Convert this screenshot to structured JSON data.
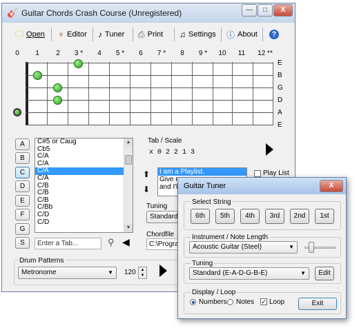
{
  "window": {
    "title": "Guitar Chords Crash Course (Unregistered)",
    "caption_min": "—",
    "caption_max": "□",
    "caption_close": "X"
  },
  "toolbar": {
    "open": "Open",
    "editor": "Editor",
    "tuner": "Tuner",
    "print": "Print",
    "settings": "Settings",
    "about": "About",
    "help": "?"
  },
  "fretboard": {
    "fret_labels": [
      "0",
      "1",
      "2",
      "3 *",
      "4",
      "5 *",
      "6",
      "7 *",
      "8",
      "9 *",
      "10",
      "11",
      "12 **"
    ],
    "string_names": [
      "E",
      "B",
      "G",
      "D",
      "A",
      "E"
    ]
  },
  "letters": [
    "A",
    "B",
    "C",
    "D",
    "E",
    "F",
    "G",
    "S"
  ],
  "selected_letter": "C",
  "chord_list": [
    "C#5 or Caug",
    "Cb5",
    "C/A",
    "C/A",
    "C/A",
    "C/A",
    "C/B",
    "C/B",
    "C/B",
    "C/Bb",
    "C/D",
    "C/D"
  ],
  "selected_chord_index": 3,
  "tab_search_placeholder": "Enter a Tab...",
  "tab_scale": {
    "label": "Tab / Scale",
    "value": "x 0 2 2 1 3"
  },
  "playlist": {
    "lines": [
      "I am a Playlist.",
      "Give m",
      "and I'l"
    ],
    "checkbox_label": "Play List"
  },
  "tuning": {
    "label": "Tuning",
    "value": "Standard ("
  },
  "chordfile": {
    "label": "Chordfile",
    "value": "C:\\Program"
  },
  "drum": {
    "label": "Drum Patterns",
    "value": "Metronome",
    "tempo": "120"
  },
  "tuner": {
    "title": "Guitar Tuner",
    "select_string_label": "Select String",
    "strings": [
      "6th",
      "5th",
      "4th",
      "3rd",
      "2nd",
      "1st"
    ],
    "instrument_label": "Instrument / Note Length",
    "instrument_value": "Acoustic Guitar (Steel)",
    "tuning_label": "Tuning",
    "tuning_value": "Standard (E-A-D-G-B-E)",
    "edit_label": "Edit",
    "display_label": "Display / Loop",
    "numbers_label": "Numbers",
    "notes_label": "Notes",
    "loop_label": "Loop",
    "exit_label": "Exit",
    "close": "X"
  }
}
